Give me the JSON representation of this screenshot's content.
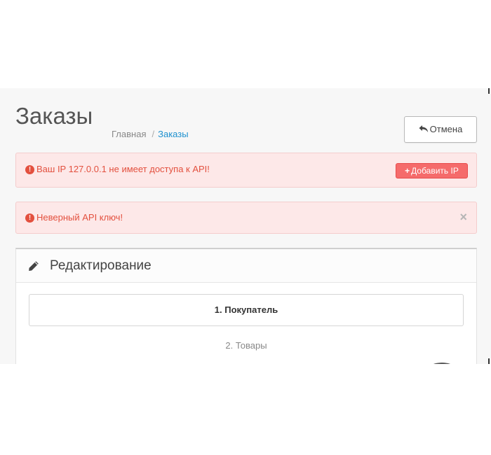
{
  "header": {
    "title": "Заказы",
    "breadcrumb": [
      "Главная",
      "Заказы"
    ],
    "breadcrumb_separator": "/",
    "cancel_label": "Отмена",
    "cancel_icon": "reply-icon"
  },
  "alerts": [
    {
      "icon": "exclamation-circle-icon",
      "text": "Ваш IP 127.0.0.1 не имеет доступа к API!",
      "button_label": "Добавить IP",
      "button_icon": "plus-icon"
    },
    {
      "icon": "exclamation-circle-icon",
      "text": "Неверный API ключ!",
      "close_label": "×"
    }
  ],
  "panel": {
    "icon": "pencil-icon",
    "title": "Редактирование",
    "steps": [
      {
        "label": "1. Покупатель",
        "active": true
      },
      {
        "label": "2. Товары",
        "active": false
      }
    ]
  },
  "colors": {
    "accent_link": "#1e91cf",
    "danger_text": "#e3503e",
    "danger_bg": "#fde8e8",
    "danger_button": "#f56b6b"
  }
}
